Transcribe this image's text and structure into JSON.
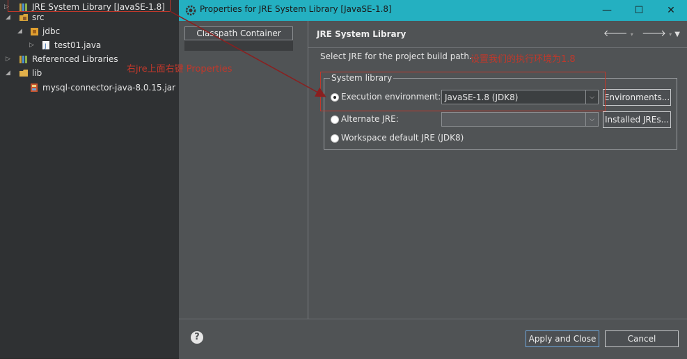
{
  "explorer": {
    "items": [
      {
        "label": "JRE System Library [JavaSE-1.8]",
        "icon": "library-icon"
      },
      {
        "label": "src",
        "icon": "package-folder-icon"
      },
      {
        "label": "jdbc",
        "icon": "package-icon"
      },
      {
        "label": "test01.java",
        "icon": "java-file-icon"
      },
      {
        "label": "Referenced Libraries",
        "icon": "library-icon"
      },
      {
        "label": "lib",
        "icon": "folder-icon"
      },
      {
        "label": "mysql-connector-java-8.0.15.jar",
        "icon": "jar-icon"
      }
    ]
  },
  "dialog": {
    "title": "Properties for JRE System Library [JavaSE-1.8]",
    "nav_item": "Classpath Container",
    "page_title": "JRE System Library",
    "description": "Select JRE for the project build path.",
    "group_label": "System library",
    "options": {
      "exec_env_label": "Execution environment:",
      "exec_env_value": "JavaSE-1.8 (JDK8)",
      "environments_button": "Environments...",
      "alternate_label": "Alternate JRE:",
      "alternate_value": "",
      "installed_button": "Installed JREs...",
      "workspace_label": "Workspace default JRE (JDK8)"
    },
    "footer": {
      "apply_close": "Apply and Close",
      "cancel": "Cancel"
    }
  },
  "annotations": {
    "annot_right_click": "右jre上面右键 Properties",
    "annot_set_env": "设置我们的执行环境为1.8"
  },
  "colors": {
    "titlebar": "#24b0c1",
    "annotation": "#c0382b",
    "dialog_bg": "#505355"
  }
}
